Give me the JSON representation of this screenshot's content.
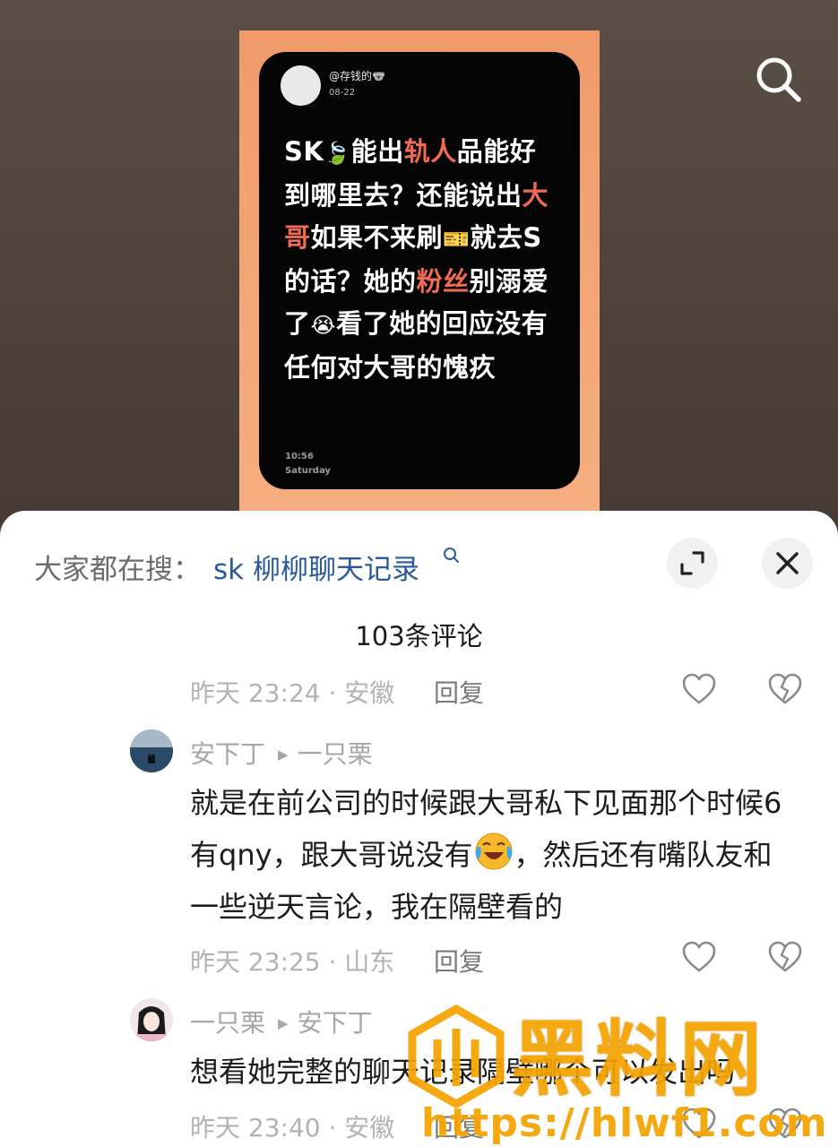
{
  "post": {
    "handle": "@存钱的🐨",
    "date": "08-22",
    "body_segments": [
      {
        "text": "SK",
        "hl": false
      },
      {
        "text": "🍃",
        "hl": false,
        "emoji": true
      },
      {
        "text": "能出",
        "hl": false
      },
      {
        "text": "轨人",
        "hl": true
      },
      {
        "text": "品能好到哪里去？还能说出",
        "hl": false
      },
      {
        "text": "大哥",
        "hl": true
      },
      {
        "text": "如果不来刷",
        "hl": false
      },
      {
        "text": "🎫",
        "hl": false,
        "emoji": true
      },
      {
        "text": "就去S的话？她的",
        "hl": false
      },
      {
        "text": "粉丝",
        "hl": true
      },
      {
        "text": "别溺爱了",
        "hl": false
      },
      {
        "text": "😭",
        "hl": false,
        "emoji": true
      },
      {
        "text": "看了她的回应没有任何对大哥的愧疚",
        "hl": false
      }
    ],
    "time": "10:56",
    "day": "Saturday"
  },
  "search": {
    "icon": "search-icon"
  },
  "sheet": {
    "trend_prefix": "大家都在搜：",
    "trend_query": "sk 柳柳聊天记录",
    "comment_count": "103条评论"
  },
  "comments": [
    {
      "time_location": "昨天 23:24 · 安徽",
      "reply_label": "回复"
    },
    {
      "author": "安下丁",
      "reply_to": "一只栗",
      "text_before": "就是在前公司的时候跟大哥私下见面那个时候6有qny，跟大哥说没有",
      "text_after": "，然后还有嘴队友和一些逆天言论，我在隔壁看的",
      "time_location": "昨天 23:25 · 山东",
      "reply_label": "回复"
    },
    {
      "author": "一只栗",
      "reply_to": "安下丁",
      "text": "想看她完整的聊天记录隔壁哪个可以发出吗",
      "time_location": "昨天 23:40 · 安徽",
      "reply_label": "回复"
    }
  ],
  "watermark": {
    "title": "黑料网",
    "url": "https://hlwf1.com"
  },
  "colors": {
    "accent_link": "#2b5a9a",
    "highlight": "#f06a55",
    "watermark": "#f5a300"
  }
}
